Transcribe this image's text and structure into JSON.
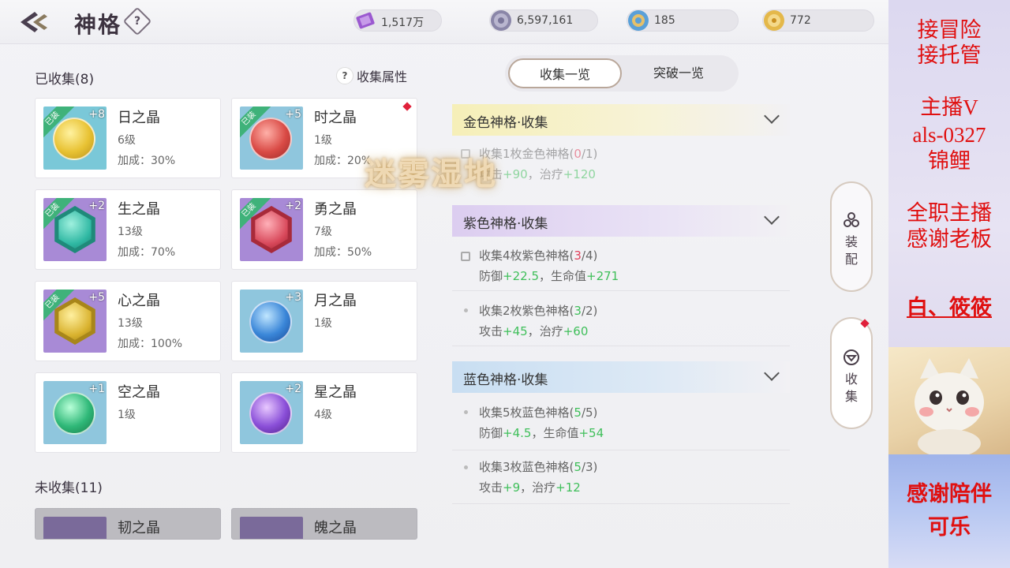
{
  "header": {
    "title": "神格",
    "help": "?",
    "resources": [
      {
        "icon": "purple-ticket-icon",
        "value": "1,517万",
        "color": "#9b59d0"
      },
      {
        "icon": "silver-coin-icon",
        "value": "6,597,161",
        "color": "#8a86a8"
      },
      {
        "icon": "blue-crystal-icon",
        "value": "185",
        "color": "#5aa0d8"
      },
      {
        "icon": "gold-coin-icon",
        "value": "772",
        "color": "#e4b84a"
      }
    ]
  },
  "collected": {
    "label": "已收集(8)",
    "attr_label": "收集属性",
    "attr_icon": "?",
    "equipped_tag": "已装",
    "items": [
      {
        "name": "日之晶",
        "level": "6级",
        "bonus": "加成：30%",
        "plus": "+8",
        "equipped": true,
        "color": "#e8c233",
        "tile": "#7ac8d8"
      },
      {
        "name": "时之晶",
        "level": "1级",
        "bonus": "加成：20%",
        "plus": "+5",
        "equipped": true,
        "color": "#d94a45",
        "tile": "#8fc6dd"
      },
      {
        "name": "生之晶",
        "level": "13级",
        "bonus": "加成：70%",
        "plus": "+2",
        "equipped": true,
        "color": "#2fb8a3",
        "tile": "#a88ad6"
      },
      {
        "name": "勇之晶",
        "level": "7级",
        "bonus": "加成：50%",
        "plus": "+2",
        "equipped": true,
        "color": "#d8485a",
        "tile": "#a88ad6"
      },
      {
        "name": "心之晶",
        "level": "13级",
        "bonus": "加成：100%",
        "plus": "+5",
        "equipped": true,
        "color": "#d9b22e",
        "tile": "#a88ad6"
      },
      {
        "name": "月之晶",
        "level": "1级",
        "bonus": "",
        "plus": "+3",
        "equipped": false,
        "color": "#3a86d8",
        "tile": "#8fc6dd"
      },
      {
        "name": "空之晶",
        "level": "1级",
        "bonus": "",
        "plus": "+1",
        "equipped": false,
        "color": "#2fb878",
        "tile": "#8fc6dd"
      },
      {
        "name": "星之晶",
        "level": "4级",
        "bonus": "",
        "plus": "+2",
        "equipped": false,
        "color": "#8a4fd8",
        "tile": "#8fc6dd"
      }
    ]
  },
  "uncollected": {
    "label": "未收集(11)",
    "items": [
      {
        "name": "韧之晶"
      },
      {
        "name": "魄之晶"
      }
    ]
  },
  "tabs": {
    "active": "收集一览",
    "other": "突破一览"
  },
  "groups": {
    "gold": {
      "title": "金色神格·收集",
      "entries": [
        {
          "prefix": "收集1枚金色神格(",
          "count": "0",
          "total": "/1)",
          "locked": true,
          "stat1": "攻击",
          "val1": "+90",
          "sep": "，",
          "stat2": "治疗",
          "val2": "+120"
        }
      ]
    },
    "purple": {
      "title": "紫色神格·收集",
      "entries": [
        {
          "prefix": "收集4枚紫色神格(",
          "count": "3",
          "total": "/4)",
          "locked": true,
          "stat1": "防御",
          "val1": "+22.5",
          "sep": "，",
          "stat2": "生命值",
          "val2": "+271"
        },
        {
          "prefix": "收集2枚紫色神格(",
          "count": "3",
          "total": "/2)",
          "locked": false,
          "stat1": "攻击",
          "val1": "+45",
          "sep": "，",
          "stat2": "治疗",
          "val2": "+60"
        }
      ]
    },
    "blue": {
      "title": "蓝色神格·收集",
      "entries": [
        {
          "prefix": "收集5枚蓝色神格(",
          "count": "5",
          "total": "/5)",
          "locked": false,
          "stat1": "防御",
          "val1": "+4.5",
          "sep": "，",
          "stat2": "生命值",
          "val2": "+54"
        },
        {
          "prefix": "收集3枚蓝色神格(",
          "count": "5",
          "total": "/3)",
          "locked": false,
          "stat1": "攻击",
          "val1": "+9",
          "sep": "，",
          "stat2": "治疗",
          "val2": "+12"
        }
      ]
    }
  },
  "side_buttons": {
    "equip": "装配",
    "collect": "收集"
  },
  "location_banner": "迷雾湿地",
  "stream_overlay": {
    "lines": [
      "接冒险",
      "接托管",
      "主播V",
      "als-0327",
      "锦鲤",
      "全职主播",
      "感谢老板",
      "白、筱筱",
      "感谢陪伴",
      "可乐"
    ]
  }
}
